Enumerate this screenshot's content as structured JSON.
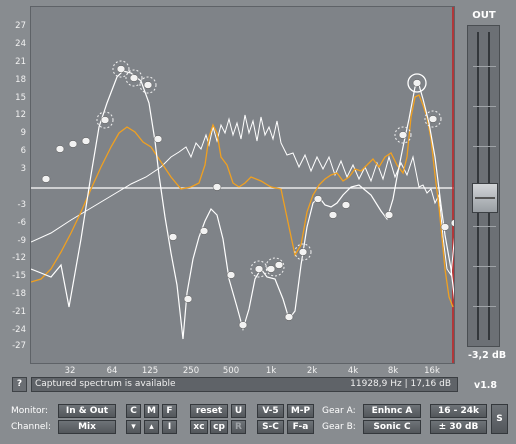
{
  "y_axis": {
    "ticks": [
      "27",
      "24",
      "21",
      "18",
      "15",
      "12",
      "9",
      "6",
      "3",
      "",
      "-3",
      "-6",
      "-9",
      "-12",
      "-15",
      "-18",
      "-21",
      "-24",
      "-27"
    ]
  },
  "x_axis": {
    "ticks": [
      "32",
      "64",
      "125",
      "250",
      "500",
      "1k",
      "2k",
      "4k",
      "8k",
      "16k"
    ]
  },
  "out": {
    "label": "OUT",
    "readout": "-3,2 dB"
  },
  "status": {
    "help_label": "?",
    "message": "Captured spectrum is available",
    "readout": "11928,9 Hz | 17,16 dB"
  },
  "version": "v1.8",
  "labels": {
    "monitor": "Monitor:",
    "channel": "Channel:",
    "gear_a": "Gear A:",
    "gear_b": "Gear B:"
  },
  "buttons": {
    "monitor_mode": "In & Out",
    "channel_mode": "Mix",
    "c": "C",
    "m": "M",
    "f": "F",
    "down": "▾",
    "up": "▴",
    "i": "I",
    "reset": "reset",
    "u": "U",
    "xc": "xc",
    "cp": "cp",
    "r": "R",
    "v5": "V-5",
    "mp": "M-P",
    "sc": "S-C",
    "fa": "F-a",
    "gear_a": "Enhnc A",
    "gear_b": "Sonic C",
    "range_freq": "16 - 24k",
    "range_db": "± 30 dB",
    "s": "S"
  },
  "colors": {
    "background": "#888c90",
    "plot": "#7f8388",
    "white_curve": "#ffffff",
    "orange_curve": "#f0a020",
    "red_marker": "#c02020"
  }
}
